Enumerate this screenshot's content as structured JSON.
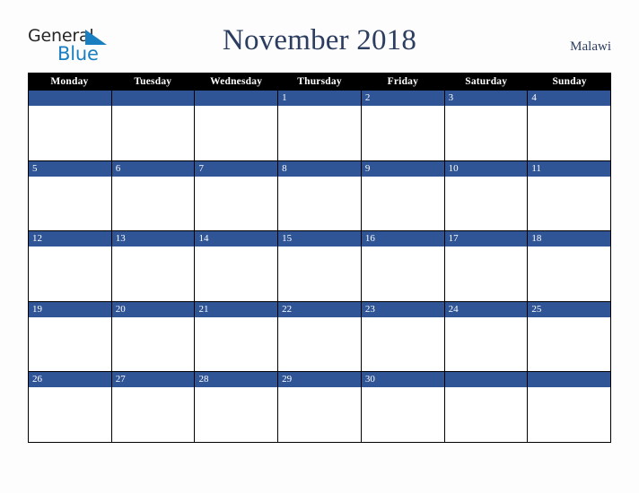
{
  "brand": {
    "name_part1": "General",
    "name_part2": "Blue",
    "triangle_color": "#1a7fc1",
    "text_color": "#262626"
  },
  "header": {
    "title": "November 2018",
    "region": "Malawi",
    "title_color": "#2c3e60"
  },
  "calendar": {
    "month": "November",
    "year": "2018",
    "accent_color": "#2f5597",
    "header_bg": "#000000",
    "weekday_headers": [
      "Monday",
      "Tuesday",
      "Wednesday",
      "Thursday",
      "Friday",
      "Saturday",
      "Sunday"
    ],
    "weeks": [
      [
        "",
        "",
        "",
        "1",
        "2",
        "3",
        "4"
      ],
      [
        "5",
        "6",
        "7",
        "8",
        "9",
        "10",
        "11"
      ],
      [
        "12",
        "13",
        "14",
        "15",
        "16",
        "17",
        "18"
      ],
      [
        "19",
        "20",
        "21",
        "22",
        "23",
        "24",
        "25"
      ],
      [
        "26",
        "27",
        "28",
        "29",
        "30",
        "",
        ""
      ]
    ]
  }
}
